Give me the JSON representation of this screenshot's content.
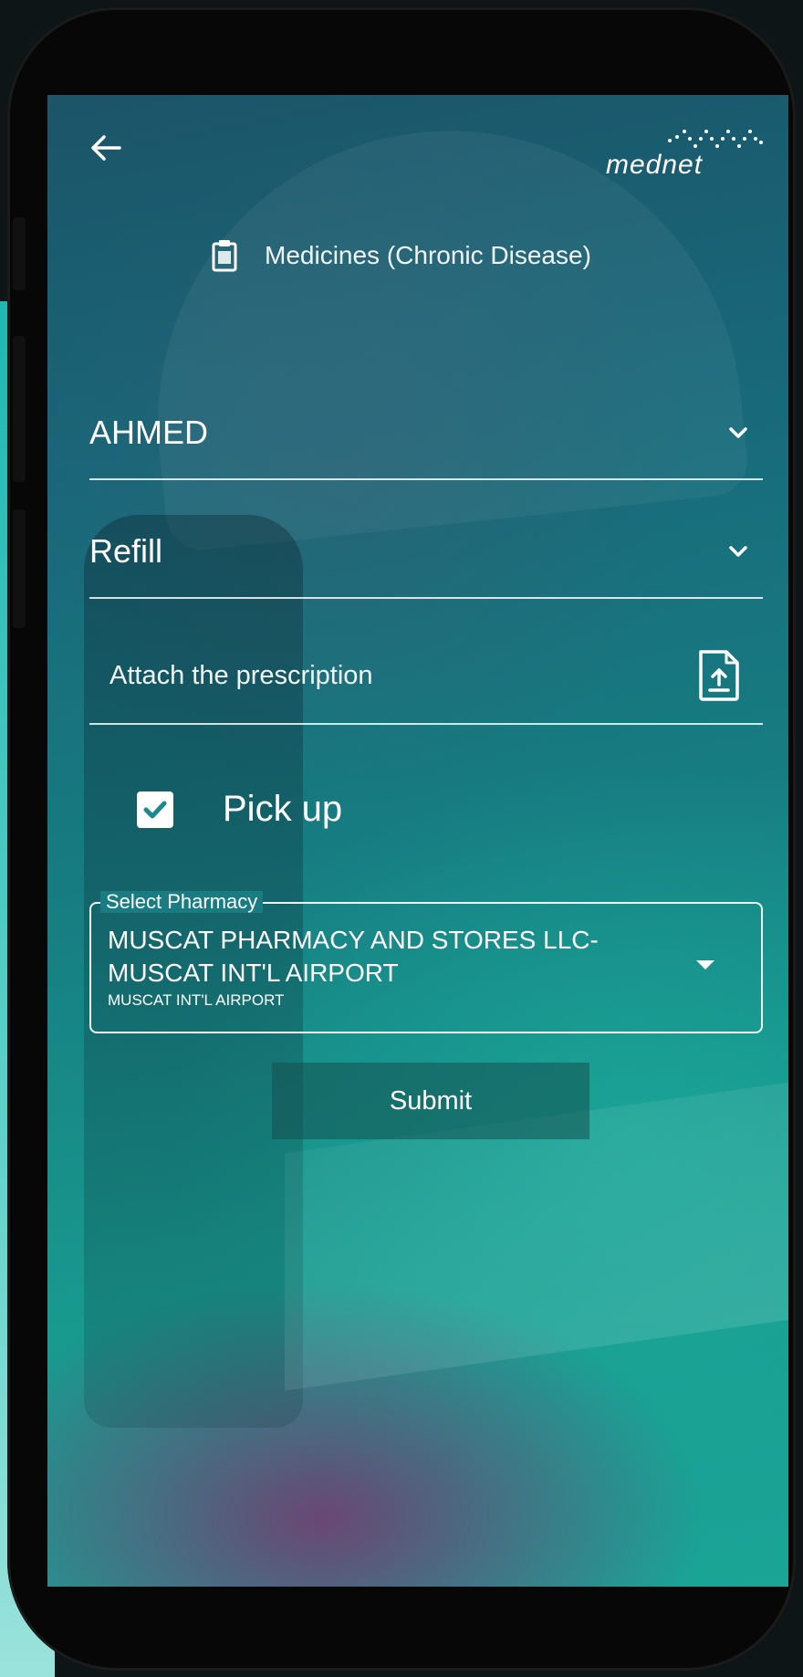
{
  "header": {
    "brand": "mednet",
    "title": "Medicines (Chronic Disease)",
    "back_icon": "arrow-left-icon",
    "title_icon": "clipboard-icon"
  },
  "form": {
    "member_value": "AHMED",
    "request_type_value": "Refill",
    "attach_label": "Attach the prescription",
    "attach_icon": "file-upload-icon",
    "pickup": {
      "label": "Pick up",
      "checked": true
    },
    "pharmacy": {
      "legend": "Select Pharmacy",
      "name": "MUSCAT PHARMACY AND STORES LLC- MUSCAT INT'L AIRPORT",
      "subtitle": "MUSCAT INT'L AIRPORT"
    },
    "submit_label": "Submit"
  },
  "colors": {
    "teal_top": "#1c5468",
    "teal_bottom": "#1aa597",
    "accent_purple": "#78376e",
    "checkbox_check": "#1b8a8c"
  }
}
